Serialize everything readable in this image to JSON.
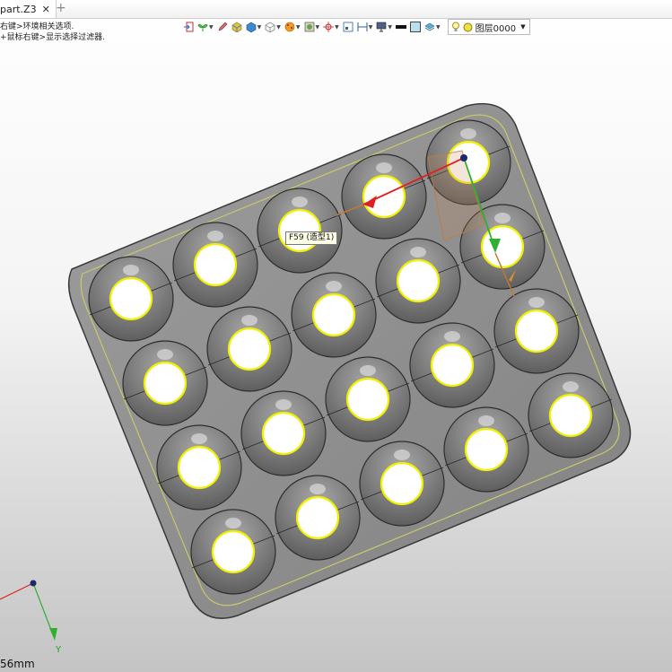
{
  "tab": {
    "title": "part.Z3",
    "close_glyph": "✕",
    "new_glyph": "+"
  },
  "hints": [
    "右键>环境相关选项.",
    "+鼠标右键>显示选择过滤器."
  ],
  "toolbar": {
    "icons": [
      "import-icon",
      "plant-icon",
      "pen-icon",
      "shaded-cube-icon",
      "blue-cube-icon",
      "wire-cube-icon",
      "render-ball-icon",
      "display-image-icon",
      "origin-icon",
      "frame-icon",
      "dimension-icon",
      "monitor-icon",
      "line-color-swatch-icon",
      "fill-color-swatch-icon",
      "layer-stack-icon"
    ],
    "layer": {
      "bulb_icon": "lightbulb-icon",
      "sun_icon": "layer-color-icon",
      "label": "图层0000"
    }
  },
  "tooltip": "F59 (造型1)",
  "scale_label": "56mm",
  "triad": {
    "y_label": "Y"
  },
  "colors": {
    "tray": "#8f8f8f",
    "tray_edge": "#3a3a3a",
    "tray_rim": "#b5b86a",
    "cup": "#7d7d7d",
    "hole": "#ffffff",
    "highlight": "#f0f000",
    "axis_x": "#e02020",
    "axis_y": "#30b030",
    "axis_z": "#1a2a6a"
  }
}
